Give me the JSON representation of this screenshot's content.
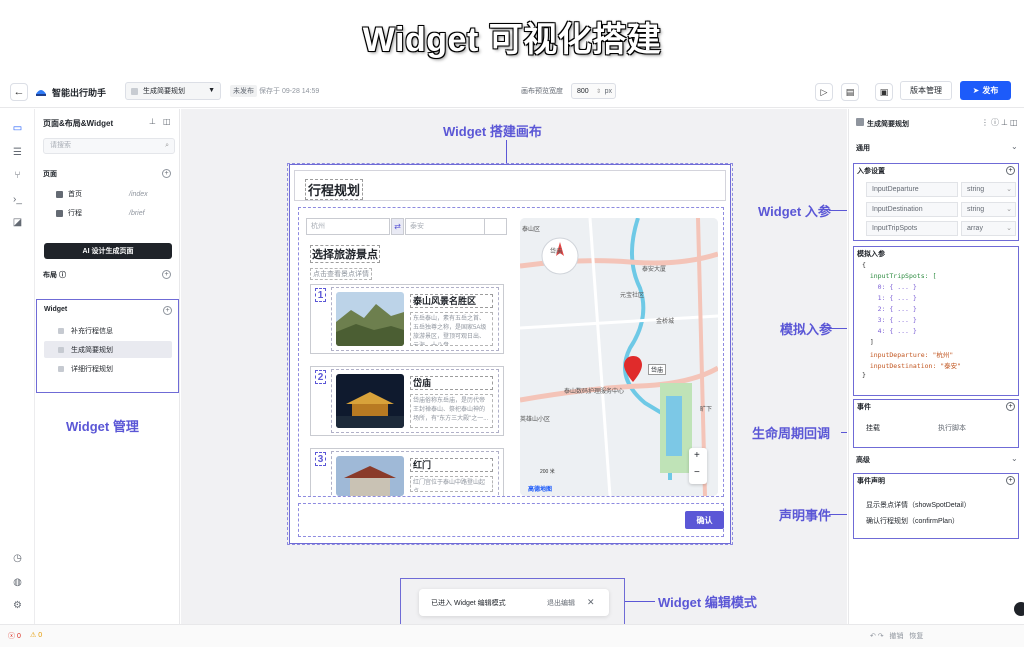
{
  "banner": {
    "title": "Widget 可视化搭建"
  },
  "topbar": {
    "app_name": "智能出行助手",
    "widget_select": "生成简要规划",
    "status": "未发布",
    "save_time": "保存于 09-28 14:59",
    "canvas_width_label": "画布预览宽度",
    "canvas_width_value": "800",
    "canvas_width_unit": "px",
    "version_label": "版本管理",
    "publish_label": "发布"
  },
  "left_panel": {
    "title": "页面&布局&Widget",
    "search_placeholder": "请搜索",
    "pages_label": "页面",
    "pages": [
      {
        "name": "首页",
        "path": "/index"
      },
      {
        "name": "行程",
        "path": "/brief"
      }
    ],
    "ai_button": "AI 设计生成页面",
    "layout_label": "布局",
    "widget_label": "Widget",
    "widgets": [
      "补充行程信息",
      "生成简要规划",
      "详细行程规划"
    ],
    "widget_annotation": "Widget 管理"
  },
  "canvas": {
    "annotation": "Widget 搭建画布",
    "card_title": "行程规划",
    "from_city": "杭州",
    "to_city": "泰安",
    "section_title": "选择旅游景点",
    "section_sub": "点击查看景点详情",
    "spots": [
      {
        "num": "1",
        "name": "泰山风景名胜区",
        "desc": "东岳泰山，素有五岳之首、五岳独尊之称，是国家5A级旅游景区，登顶可观日出、云海、十八盘..."
      },
      {
        "num": "2",
        "name": "岱庙",
        "desc": "岱庙俗称东岳庙，是历代帝王封禅泰山、祭祀泰山神的场所，有\"东方三大殿\"之一..."
      },
      {
        "num": "3",
        "name": "红门",
        "desc": "红门宫位于泰山中路登山起点..."
      }
    ],
    "map": {
      "labels": [
        "泰山区",
        "岱庙",
        "泰安大厦",
        "元宝社区",
        "金桥城",
        "泰山数码护理服务中心",
        "岱宗",
        "英雄山小区",
        "旷下",
        "泰山数码"
      ],
      "pin_label": "岱庙",
      "scale": "200 米",
      "logo": "高德地图",
      "zoom_in": "+",
      "zoom_out": "−"
    },
    "confirm_label": "确认"
  },
  "toast": {
    "message": "已进入 Widget 编辑模式",
    "exit_label": "退出编辑",
    "annotation": "Widget 编辑模式"
  },
  "right_panel": {
    "title": "生成简要规划",
    "general_label": "通用",
    "input_params_label": "入参设置",
    "input_params": [
      {
        "name": "InputDeparture",
        "type": "string"
      },
      {
        "name": "InputDestination",
        "type": "string"
      },
      {
        "name": "InputTripSpots",
        "type": "array"
      }
    ],
    "input_params_annotation": "Widget 入参",
    "mock_label": "模拟入参",
    "mock_annotation": "模拟入参",
    "mock_lines": [
      "{",
      "  inputTripSpots: [",
      "    0: { ... }",
      "    1: { ... }",
      "    2: { ... }",
      "    3: { ... }",
      "    4: { ... }",
      "  ]",
      "  inputDeparture: \"杭州\"",
      "  inputDestination: \"泰安\"",
      "}"
    ],
    "events_label": "事件",
    "lifecycle_name": "挂载",
    "lifecycle_action": "执行脚本",
    "lifecycle_annotation": "生命周期回调",
    "advanced_label": "高级",
    "declare_label": "事件声明",
    "declared_events": [
      "显示景点详情（showSpotDetail）",
      "确认行程规划（confirmPlan）"
    ],
    "declare_annotation": "声明事件"
  },
  "statusbar": {
    "errors": "0",
    "warnings": "0",
    "undo": "撤销",
    "redo": "恢复"
  },
  "colors": {
    "accent": "#5b57d6",
    "publish": "#1d5bfa"
  }
}
